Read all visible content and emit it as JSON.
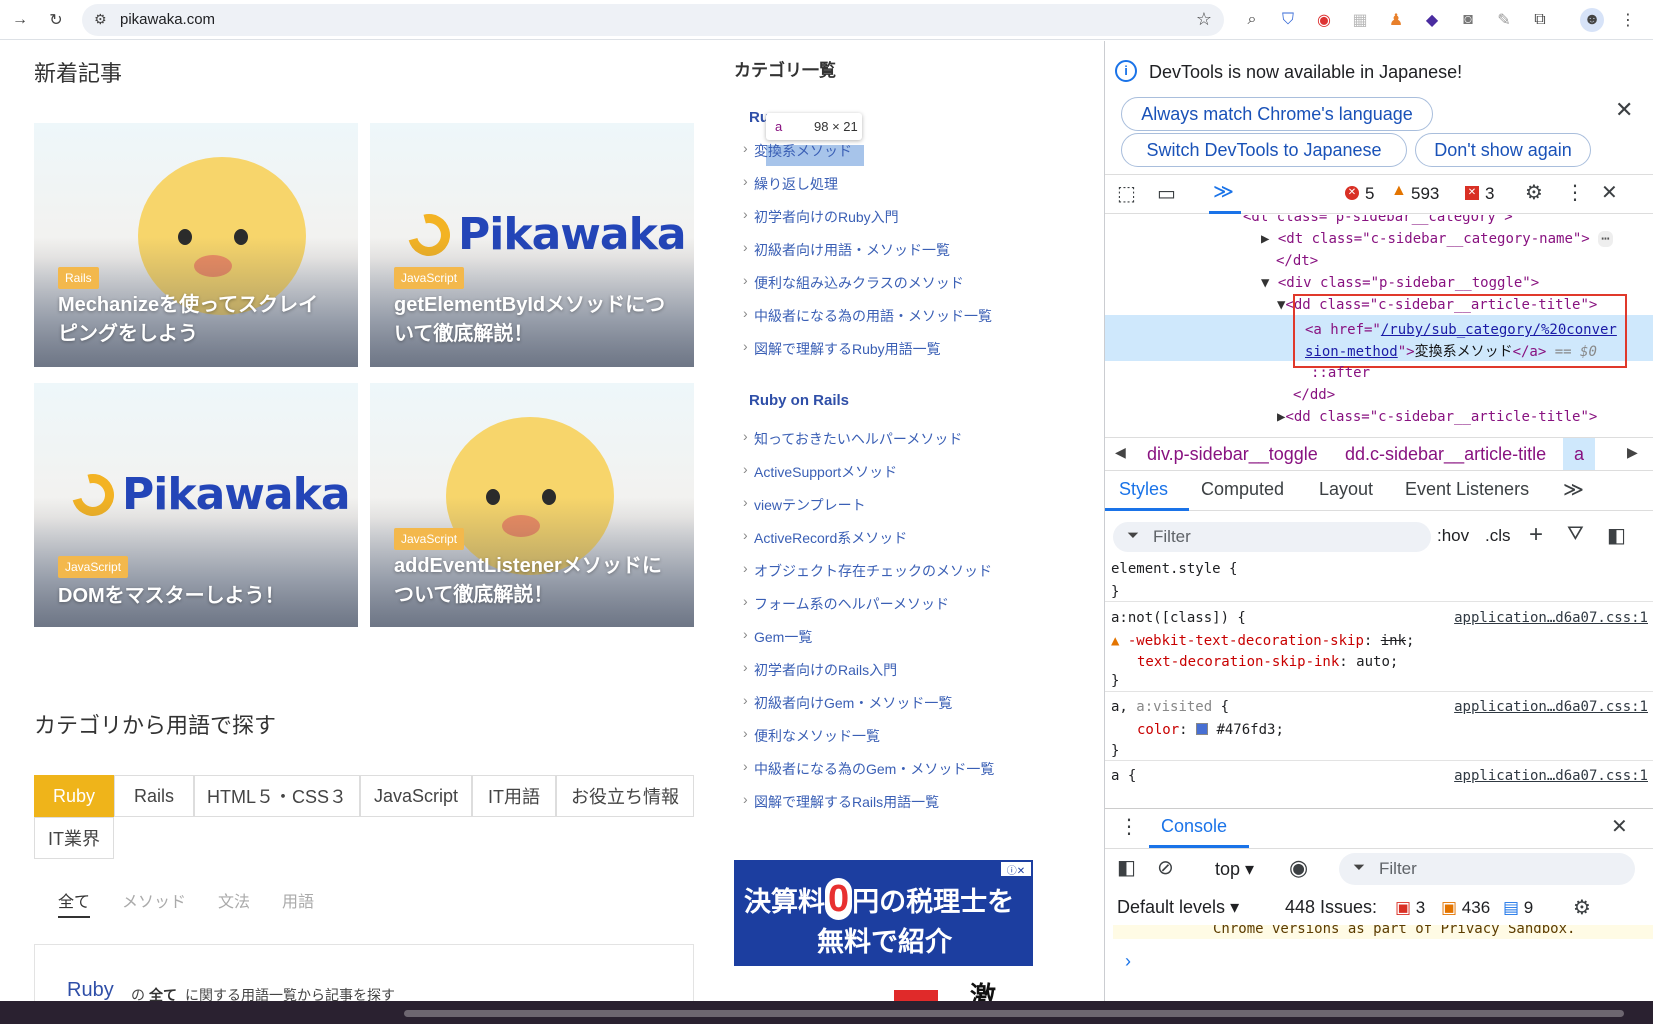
{
  "browser": {
    "url": "pikawaka.com"
  },
  "page": {
    "new_articles_title": "新着記事",
    "cards": [
      {
        "badge": "Rails",
        "title_line1": "Mechanizeを使ってスクレイ",
        "title_line2": "ピングをしよう"
      },
      {
        "badge": "JavaScript",
        "title_line1": "getElementByIdメソッドにつ",
        "title_line2": "いて徹底解説！",
        "logo": "Pikawaka"
      },
      {
        "badge": "JavaScript",
        "title_line1": "DOMをマスターしよう！",
        "title_line2": "",
        "logo": "Pikawaka"
      },
      {
        "badge": "JavaScript",
        "title_line1": "addEventListenerメソッドに",
        "title_line2": "ついて徹底解説！"
      }
    ],
    "category_search_title": "カテゴリから用語で探す",
    "tabs": [
      "Ruby",
      "Rails",
      "HTML５・CSS３",
      "JavaScript",
      "IT用語",
      "お役立ち情報",
      "IT業界"
    ],
    "subtabs": [
      "全て",
      "メソッド",
      "文法",
      "用語"
    ],
    "bottom": {
      "ruby": "Ruby",
      "no": "の",
      "all": "全て",
      "suffix": "に関する用語一覧から記事を探す"
    }
  },
  "sidebar": {
    "title": "カテゴリ一覧",
    "ruby_head": "Ru",
    "tooltip": {
      "tag": "a",
      "size": "98 × 21"
    },
    "ruby_links": [
      "変換系メソッド",
      "繰り返し処理",
      "初学者向けのRuby入門",
      "初級者向け用語・メソッド一覧",
      "便利な組み込みクラスのメソッド",
      "中級者になる為の用語・メソッド一覧",
      "図解で理解するRuby用語一覧"
    ],
    "rails_head": "Ruby on Rails",
    "rails_links": [
      "知っておきたいヘルパーメソッド",
      "ActiveSupportメソッド",
      "viewテンプレート",
      "ActiveRecord系メソッド",
      "オブジェクト存在チェックのメソッド",
      "フォーム系のヘルパーメソッド",
      "Gem一覧",
      "初学者向けのRails入門",
      "初級者向けGem・メソッド一覧",
      "便利なメソッド一覧",
      "中級者になる為のGem・メソッド一覧",
      "図解で理解するRails用語一覧"
    ],
    "ad": {
      "line1a": "決算料",
      "zero": "0",
      "line1b": "円の税理士を",
      "line2": "無料で紹介",
      "partial": "激"
    }
  },
  "devtools": {
    "banner": "DevTools is now available in Japanese!",
    "btn_match": "Always match Chrome's language",
    "btn_switch": "Switch DevTools to Japanese",
    "btn_dont": "Don't show again",
    "errors": "5",
    "warnings": "593",
    "issues_badge": "3",
    "dom": {
      "l0": "<dl class=\"p-sidebar__category\">",
      "l1": "<dt class=\"c-sidebar__category-name\">",
      "l1b": "</dt>",
      "l2": "<div class=\"p-sidebar__toggle\">",
      "l3": "<dd class=\"c-sidebar__article-title\">",
      "l4a": "<a href=\"",
      "l4href1": "/ruby/sub_category/%20conver",
      "l4href2": "sion-method",
      "l4b": "\">",
      "l4text": "変換系メソッド",
      "l4c": "</a>",
      "l4d": "== $0",
      "l5": "::after",
      "l6": "</dd>",
      "l7": "<dd class=\"c-sidebar__article-title\">"
    },
    "crumbs": [
      "div.p-sidebar__toggle",
      "dd.c-sidebar__article-title",
      "a"
    ],
    "style_tabs": [
      "Styles",
      "Computed",
      "Layout",
      "Event Listeners"
    ],
    "filter": "Filter",
    "hov": ":hov",
    "cls": ".cls",
    "rules": {
      "r1": "element.style {",
      "r1e": "}",
      "r2": "a:not([class]) {",
      "r2src": "application…d6a07.css:1",
      "r2p1": "-webkit-text-decoration-skip",
      "r2v1": "ink",
      "r2p2": "text-decoration-skip-ink",
      "r2v2": "auto",
      "r2e": "}",
      "r3": "a, a:visited {",
      "r3src": "application…d6a07.css:1",
      "r3p": "color",
      "r3v": "#476fd3",
      "r3e": "}",
      "r4": "a {",
      "r4src": "application…d6a07.css:1"
    },
    "console": {
      "title": "Console",
      "context": "top",
      "filter": "Filter",
      "levels": "Default levels",
      "issues_label": "448 Issues:",
      "n1": "3",
      "n2": "436",
      "n3": "9",
      "msg": "Chrome versions as part of Privacy Sandbox."
    }
  },
  "colors": {
    "accent": "#efb41a",
    "link": "#3a5fb5",
    "devtools_blue": "#1a73e8"
  }
}
